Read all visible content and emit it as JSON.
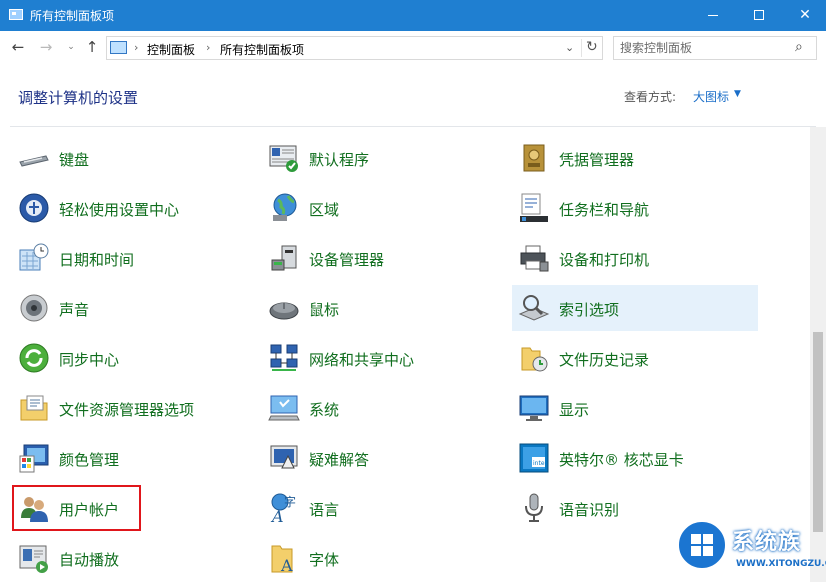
{
  "window": {
    "title": "所有控制面板项",
    "buttons": {
      "minimize": "—",
      "maximize": "□",
      "close": "✕"
    }
  },
  "nav": {
    "back": "←",
    "forward": "→",
    "recent": "⌄",
    "up": "↑",
    "breadcrumb": [
      "控制面板",
      "所有控制面板项"
    ],
    "dropdown": "⌄",
    "refresh": "↻"
  },
  "search": {
    "placeholder": "搜索控制面板",
    "icon": "search-icon"
  },
  "header": {
    "title": "调整计算机的设置",
    "view_by_label": "查看方式:",
    "view_by_value": "大图标",
    "view_by_caret": "▼"
  },
  "items": [
    {
      "label": "键盘",
      "icon": "keyboard-icon"
    },
    {
      "label": "轻松使用设置中心",
      "icon": "ease-of-access-icon"
    },
    {
      "label": "日期和时间",
      "icon": "calendar-clock-icon"
    },
    {
      "label": "声音",
      "icon": "speaker-icon"
    },
    {
      "label": "同步中心",
      "icon": "sync-icon"
    },
    {
      "label": "文件资源管理器选项",
      "icon": "folder-options-icon"
    },
    {
      "label": "颜色管理",
      "icon": "color-management-icon"
    },
    {
      "label": "用户帐户",
      "icon": "user-accounts-icon"
    },
    {
      "label": "自动播放",
      "icon": "autoplay-icon"
    },
    {
      "label": "默认程序",
      "icon": "default-programs-icon"
    },
    {
      "label": "区域",
      "icon": "region-globe-icon"
    },
    {
      "label": "设备管理器",
      "icon": "device-manager-icon"
    },
    {
      "label": "鼠标",
      "icon": "mouse-icon"
    },
    {
      "label": "网络和共享中心",
      "icon": "network-icon"
    },
    {
      "label": "系统",
      "icon": "system-icon"
    },
    {
      "label": "疑难解答",
      "icon": "troubleshooting-icon"
    },
    {
      "label": "语言",
      "icon": "language-icon"
    },
    {
      "label": "字体",
      "icon": "fonts-icon"
    },
    {
      "label": "凭据管理器",
      "icon": "credential-manager-icon"
    },
    {
      "label": "任务栏和导航",
      "icon": "taskbar-icon"
    },
    {
      "label": "设备和打印机",
      "icon": "printer-icon"
    },
    {
      "label": "索引选项",
      "icon": "indexing-icon"
    },
    {
      "label": "文件历史记录",
      "icon": "file-history-icon"
    },
    {
      "label": "显示",
      "icon": "display-icon"
    },
    {
      "label": "英特尔® 核芯显卡",
      "icon": "intel-graphics-icon"
    },
    {
      "label": "语音识别",
      "icon": "microphone-icon"
    }
  ],
  "watermark": {
    "text": "系统族",
    "url": "WWW.XITONGZU.COM"
  }
}
